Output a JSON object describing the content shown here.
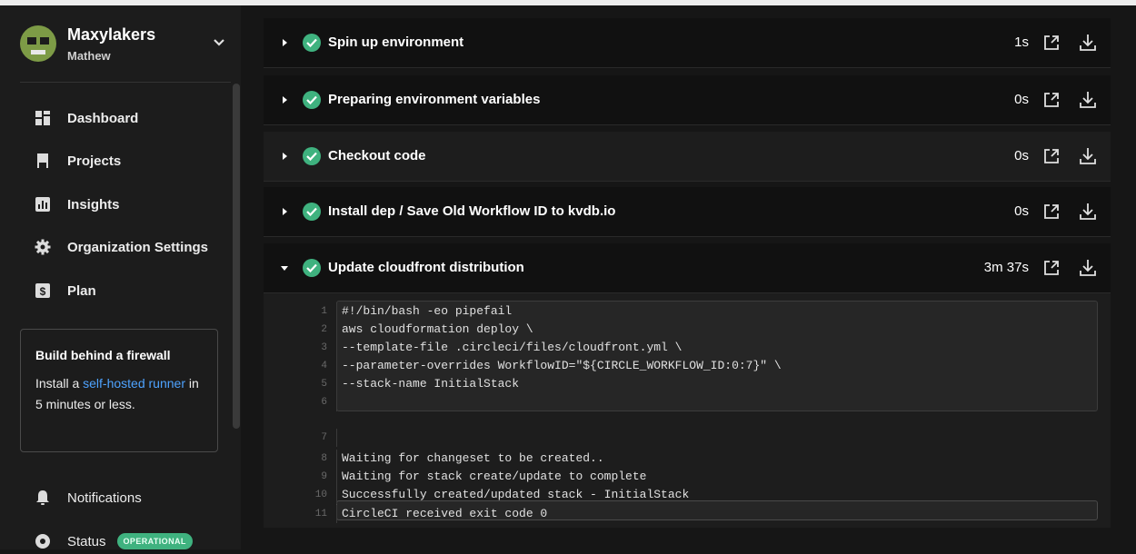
{
  "org": {
    "name": "Maxylakers",
    "user": "Mathew"
  },
  "nav": [
    {
      "label": "Dashboard",
      "icon": "dashboard-icon"
    },
    {
      "label": "Projects",
      "icon": "projects-icon"
    },
    {
      "label": "Insights",
      "icon": "insights-icon"
    },
    {
      "label": "Organization Settings",
      "icon": "gear-icon"
    },
    {
      "label": "Plan",
      "icon": "dollar-icon"
    }
  ],
  "promo": {
    "title": "Build behind a firewall",
    "text_before": "Install a ",
    "link_text": "self-hosted runner",
    "text_after": " in 5 minutes or less."
  },
  "bottom_nav": {
    "notifications": "Notifications",
    "status": "Status",
    "status_badge": "OPERATIONAL"
  },
  "steps": [
    {
      "name": "Spin up environment",
      "duration": "1s",
      "expanded": false
    },
    {
      "name": "Preparing environment variables",
      "duration": "0s",
      "expanded": false
    },
    {
      "name": "Checkout code",
      "duration": "0s",
      "expanded": false
    },
    {
      "name": "Install dep / Save Old Workflow ID to kvdb.io",
      "duration": "0s",
      "expanded": false
    },
    {
      "name": "Update cloudfront distribution",
      "duration": "3m 37s",
      "expanded": true
    }
  ],
  "log": [
    {
      "num": "1",
      "text": "#!/bin/bash -eo pipefail"
    },
    {
      "num": "2",
      "text": "aws cloudformation deploy \\"
    },
    {
      "num": "3",
      "text": "--template-file .circleci/files/cloudfront.yml \\"
    },
    {
      "num": "4",
      "text": "--parameter-overrides WorkflowID=\"${CIRCLE_WORKFLOW_ID:0:7}\" \\"
    },
    {
      "num": "5",
      "text": "--stack-name InitialStack"
    },
    {
      "num": "6",
      "text": ""
    },
    {
      "num": "7",
      "text": ""
    },
    {
      "num": "8",
      "text": "Waiting for changeset to be created.."
    },
    {
      "num": "9",
      "text": "Waiting for stack create/update to complete"
    },
    {
      "num": "10",
      "text": "Successfully created/updated stack - InitialStack"
    },
    {
      "num": "11",
      "text": "CircleCI received exit code 0"
    }
  ],
  "colors": {
    "success": "#3fb27f",
    "link": "#4ea3ff",
    "background": "#161616"
  }
}
